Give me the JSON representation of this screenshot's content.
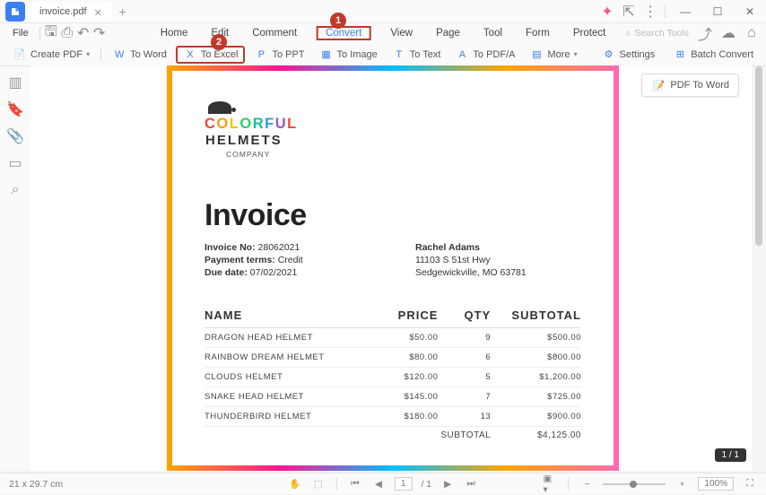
{
  "tab": {
    "title": "invoice.pdf"
  },
  "menu": {
    "file": "File",
    "items": [
      "Home",
      "Edit",
      "Comment",
      "Convert",
      "View",
      "Page",
      "Tool",
      "Form",
      "Protect"
    ],
    "active_index": 3,
    "search_placeholder": "Search Tools"
  },
  "toolbar": {
    "create_pdf": "Create PDF",
    "to_word": "To Word",
    "to_excel": "To Excel",
    "to_ppt": "To PPT",
    "to_image": "To Image",
    "to_text": "To Text",
    "to_pdfa": "To PDF/A",
    "more": "More",
    "settings": "Settings",
    "batch_convert": "Batch Convert"
  },
  "callouts": {
    "c1": "1",
    "c2": "2"
  },
  "badge": {
    "pdf_to_word": "PDF To Word"
  },
  "doc": {
    "logo_word": "COLORFUL",
    "logo_sub": "HELMETS",
    "logo_company": "COMPANY",
    "title": "Invoice",
    "invoice_no_label": "Invoice No:",
    "invoice_no": "28062021",
    "terms_label": "Payment terms:",
    "terms": "Credit",
    "due_label": "Due date:",
    "due": "07/02/2021",
    "customer_name": "Rachel Adams",
    "addr1": "11103 S 51st Hwy",
    "addr2": "Sedgewickville, MO 63781",
    "headers": {
      "name": "NAME",
      "price": "PRICE",
      "qty": "QTY",
      "subtotal": "SUBTOTAL"
    },
    "rows": [
      {
        "name": "DRAGON HEAD HELMET",
        "price": "$50.00",
        "qty": "9",
        "subtotal": "$500.00"
      },
      {
        "name": "RAINBOW DREAM HELMET",
        "price": "$80.00",
        "qty": "6",
        "subtotal": "$800.00"
      },
      {
        "name": "CLOUDS HELMET",
        "price": "$120.00",
        "qty": "5",
        "subtotal": "$1,200.00"
      },
      {
        "name": "SNAKE HEAD HELMET",
        "price": "$145.00",
        "qty": "7",
        "subtotal": "$725.00"
      },
      {
        "name": "THUNDERBIRD HELMET",
        "price": "$180.00",
        "qty": "13",
        "subtotal": "$900.00"
      }
    ],
    "subtotal_label": "SUBTOTAL",
    "subtotal": "$4,125.00"
  },
  "status": {
    "dimensions": "21 x 29.7 cm",
    "page_input": "1",
    "page_total": "/ 1",
    "zoom": "100%",
    "page_badge": "1 / 1"
  }
}
